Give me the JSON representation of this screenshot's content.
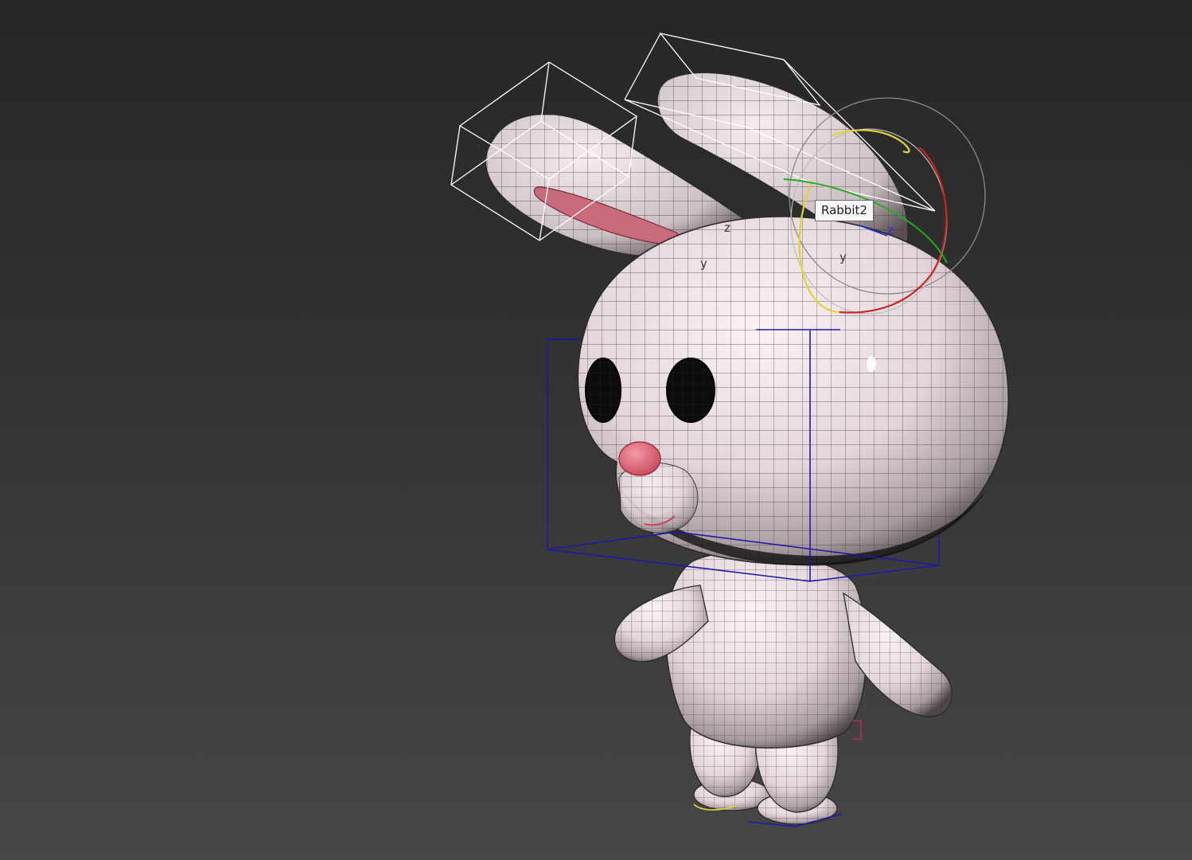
{
  "viewport": {
    "background_top": "#262626",
    "background_bottom": "#474747",
    "tooltip_label": "Rabbit2"
  },
  "colors": {
    "skin": "#d9cdd1",
    "wire": "#3a3a3a",
    "ear_inner": "#c96b7b",
    "nose": "#e06a7e",
    "selection_bbox": "#ffffff",
    "bone_box": "#1a1aa8",
    "gizmo_x": "#cc2222",
    "gizmo_y": "#22aa22",
    "gizmo_z": "#2233cc",
    "gizmo_view": "#e0d23a"
  },
  "icons": [
    "rotate-gizmo-icon",
    "axis-tripod-icon"
  ]
}
